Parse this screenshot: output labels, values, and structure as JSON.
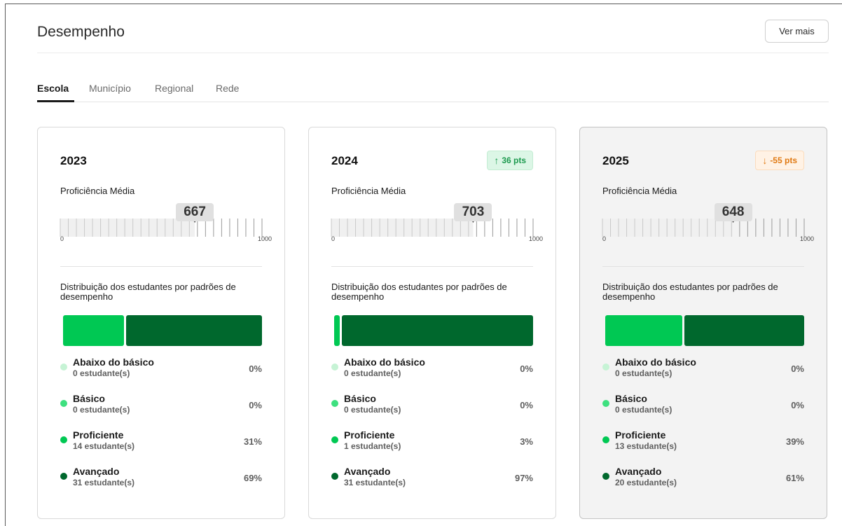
{
  "header": {
    "title": "Desempenho",
    "more_label": "Ver mais"
  },
  "tabs": [
    {
      "label": "Escola",
      "active": true
    },
    {
      "label": "Município",
      "active": false
    },
    {
      "label": "Regional",
      "active": false
    },
    {
      "label": "Rede",
      "active": false
    }
  ],
  "colors": {
    "abaixo": "#c6f3d5",
    "basico": "#3ee07f",
    "proficiente": "#00c853",
    "avancado": "#00682d"
  },
  "cards": [
    {
      "year": "2023",
      "delta": null,
      "prof_label": "Proficiência Média",
      "score": 667,
      "axis_min": "0",
      "axis_max": "1000",
      "dist_title": "Distribuição dos estudantes por padrões de desempenho",
      "legend": [
        {
          "name": "Abaixo do básico",
          "count": "0 estudante(s)",
          "pct": "0%"
        },
        {
          "name": "Básico",
          "count": "0 estudante(s)",
          "pct": "0%"
        },
        {
          "name": "Proficiente",
          "count": "14 estudante(s)",
          "pct": "31%"
        },
        {
          "name": "Avançado",
          "count": "31 estudante(s)",
          "pct": "69%"
        }
      ]
    },
    {
      "year": "2024",
      "delta": {
        "direction": "up",
        "label": "36 pts"
      },
      "prof_label": "Proficiência Média",
      "score": 703,
      "axis_min": "0",
      "axis_max": "1000",
      "dist_title": "Distribuição dos estudantes por padrões de desempenho",
      "legend": [
        {
          "name": "Abaixo do básico",
          "count": "0 estudante(s)",
          "pct": "0%"
        },
        {
          "name": "Básico",
          "count": "0 estudante(s)",
          "pct": "0%"
        },
        {
          "name": "Proficiente",
          "count": "1 estudante(s)",
          "pct": "3%"
        },
        {
          "name": "Avançado",
          "count": "31 estudante(s)",
          "pct": "97%"
        }
      ]
    },
    {
      "year": "2025",
      "delta": {
        "direction": "down",
        "label": "-55 pts"
      },
      "prof_label": "Proficiência Média",
      "score": 648,
      "axis_min": "0",
      "axis_max": "1000",
      "dist_title": "Distribuição dos estudantes por padrões de desempenho",
      "legend": [
        {
          "name": "Abaixo do básico",
          "count": "0 estudante(s)",
          "pct": "0%"
        },
        {
          "name": "Básico",
          "count": "0 estudante(s)",
          "pct": "0%"
        },
        {
          "name": "Proficiente",
          "count": "13 estudante(s)",
          "pct": "39%"
        },
        {
          "name": "Avançado",
          "count": "20 estudante(s)",
          "pct": "61%"
        }
      ]
    }
  ]
}
